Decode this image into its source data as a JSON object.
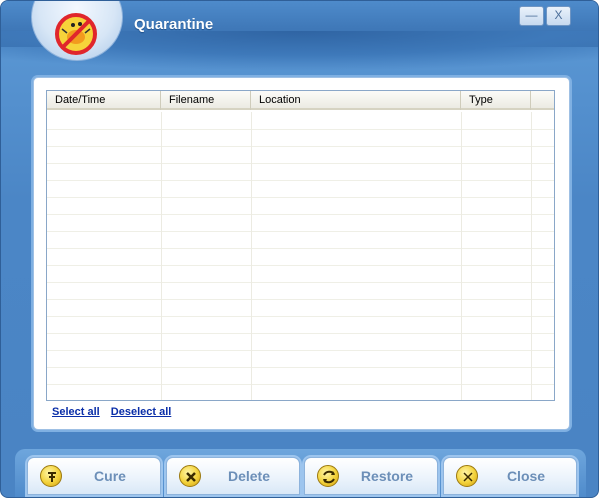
{
  "window": {
    "title": "Quarantine",
    "minimize_symbol": "—",
    "close_symbol": "X"
  },
  "table": {
    "columns": [
      "Date/Time",
      "Filename",
      "Location",
      "Type"
    ],
    "rows": []
  },
  "links": {
    "select_all": "Select all",
    "deselect_all": "Deselect all"
  },
  "buttons": {
    "cure": "Cure",
    "delete": "Delete",
    "restore": "Restore",
    "close": "Close"
  },
  "icons": {
    "logo": "no-bug-icon",
    "cure": "cure-icon",
    "delete": "delete-icon",
    "restore": "restore-icon",
    "close": "close-icon"
  },
  "colors": {
    "accent": "#4a84c4",
    "link": "#0a2ea8",
    "button_text": "#6c8fb8"
  }
}
